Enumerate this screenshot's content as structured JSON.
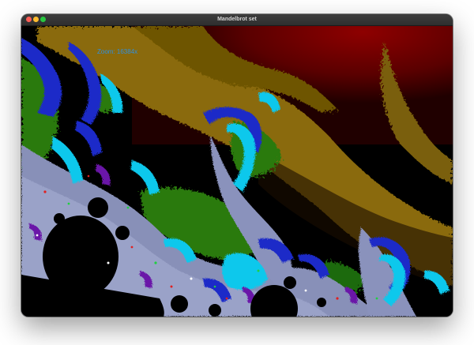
{
  "window": {
    "title": "Mandelbrot set"
  },
  "overlay": {
    "zoom_text": "Zoom: 16384x"
  },
  "palette": {
    "red": "#7d0000",
    "orange": "#8a6a08",
    "green": "#2a7a10",
    "blue": "#1a2ac8",
    "cyan": "#10c8ec",
    "purple": "#6a18a8",
    "silver": "#9aa2c8",
    "black": "#000000"
  },
  "icons": [
    "close-button",
    "minimize-button",
    "zoom-button"
  ]
}
